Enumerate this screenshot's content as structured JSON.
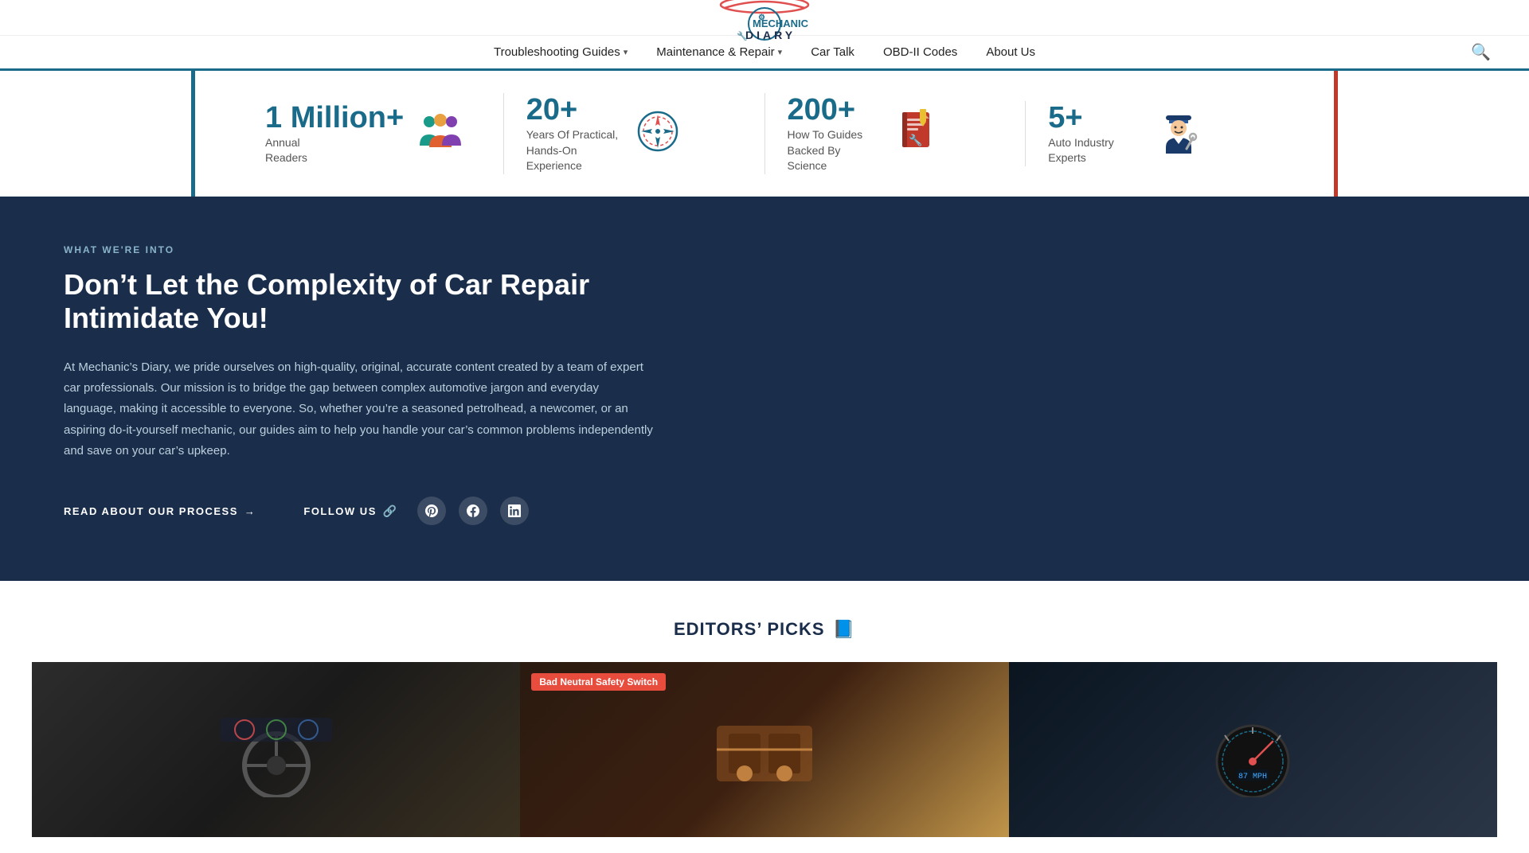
{
  "header": {
    "logo_alt": "Mechanic's Diary",
    "search_label": "Search"
  },
  "nav": {
    "items": [
      {
        "label": "Troubleshooting Guides",
        "has_dropdown": true
      },
      {
        "label": "Maintenance & Repair",
        "has_dropdown": true
      },
      {
        "label": "Car Talk",
        "has_dropdown": false
      },
      {
        "label": "OBD-II Codes",
        "has_dropdown": false
      },
      {
        "label": "About Us",
        "has_dropdown": false
      }
    ]
  },
  "stats": [
    {
      "number": "1 Million+",
      "label_line1": "Annual",
      "label_line2": "Readers",
      "icon": "readers"
    },
    {
      "number": "20+",
      "label": "Years Of Practical, Hands-On Experience",
      "icon": "gauge"
    },
    {
      "number": "200+",
      "label": "How To Guides Backed By Science",
      "icon": "book"
    },
    {
      "number": "5+",
      "label": "Auto Industry Experts",
      "icon": "expert"
    }
  ],
  "dark_section": {
    "what_label": "WHAT WE'RE INTO",
    "title": "Don’t Let the Complexity of Car Repair Intimidate You!",
    "body": "At Mechanic’s Diary, we pride ourselves on high-quality, original, accurate content created by a team of expert car professionals. Our mission is to bridge the gap between complex automotive jargon and everyday language, making it accessible to everyone. So, whether you’re a seasoned petrolhead, a newcomer, or an aspiring do-it-yourself mechanic, our guides aim to help you handle your car’s common problems independently and save on your car’s upkeep.",
    "read_link": "READ ABOUT OUR PROCESS",
    "follow_label": "FOLLOW US",
    "social": [
      {
        "name": "pinterest",
        "symbol": "P"
      },
      {
        "name": "facebook",
        "symbol": "f"
      },
      {
        "name": "linkedin",
        "symbol": "in"
      }
    ]
  },
  "editors_picks": {
    "title": "EDITORS’ PICKS",
    "icon": "📘",
    "cards": [
      {
        "badge": null,
        "bg": "dark-car"
      },
      {
        "badge": "Bad Neutral Safety Switch",
        "badge_color": "red",
        "bg": "amber"
      },
      {
        "badge": null,
        "bg": "dark-gauge"
      }
    ]
  }
}
